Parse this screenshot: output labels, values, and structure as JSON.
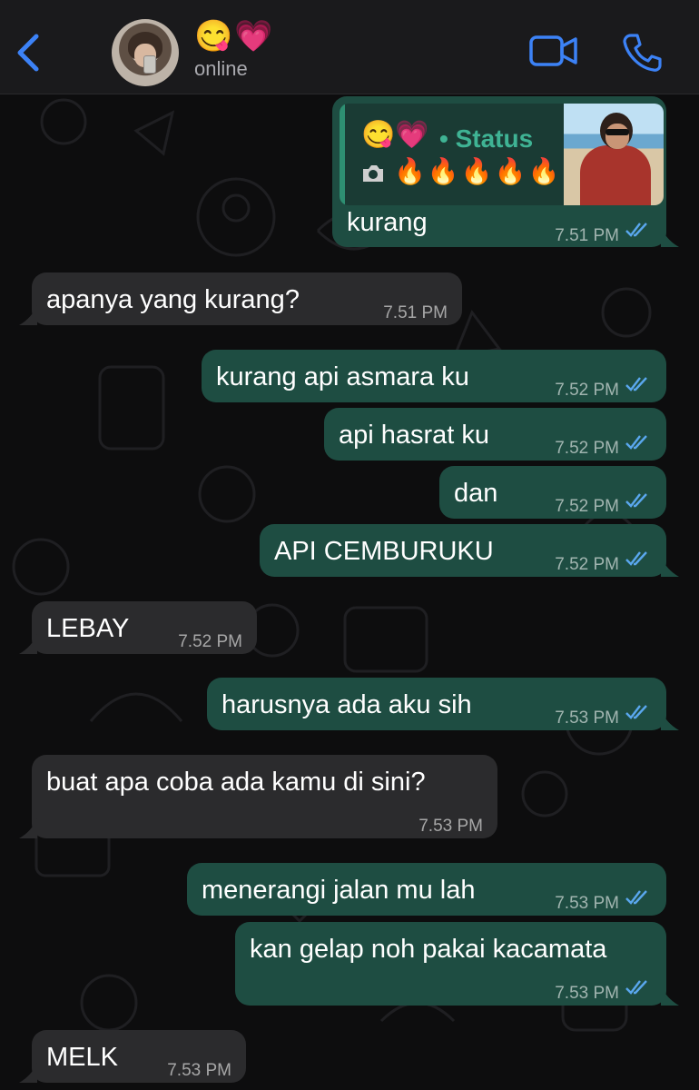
{
  "header": {
    "contact_name": "😋💗",
    "status": "online",
    "back_icon": "chevron-left-icon",
    "video_icon": "video-call-icon",
    "call_icon": "phone-icon",
    "accent_color": "#3c82f6"
  },
  "reply": {
    "emojis": "😋💗",
    "label": "• Status",
    "fires": "🔥🔥🔥🔥🔥"
  },
  "messages": [
    {
      "dir": "out",
      "text": "kurang",
      "time": "7.51 PM"
    },
    {
      "dir": "in",
      "text": "apanya yang kurang?",
      "time": "7.51 PM"
    },
    {
      "dir": "out",
      "text": "kurang api asmara ku",
      "time": "7.52 PM"
    },
    {
      "dir": "out",
      "text": "api hasrat ku",
      "time": "7.52 PM"
    },
    {
      "dir": "out",
      "text": "dan",
      "time": "7.52 PM"
    },
    {
      "dir": "out",
      "text": "API CEMBURUKU",
      "time": "7.52 PM"
    },
    {
      "dir": "in",
      "text": "LEBAY",
      "time": "7.52 PM"
    },
    {
      "dir": "out",
      "text": "harusnya ada aku sih",
      "time": "7.53 PM"
    },
    {
      "dir": "in",
      "text": "buat apa coba ada kamu di sini?",
      "time": "7.53 PM"
    },
    {
      "dir": "out",
      "text": "menerangi jalan mu lah",
      "time": "7.53 PM"
    },
    {
      "dir": "out",
      "text": "kan gelap noh pakai kacamata",
      "time": "7.53 PM"
    },
    {
      "dir": "in",
      "text": "MELK",
      "time": "7.53 PM"
    }
  ],
  "colors": {
    "outgoing_bubble": "#1e4d42",
    "incoming_bubble": "#2b2b2d",
    "read_ticks": "#5aa7ee",
    "status_label": "#3fb394"
  }
}
